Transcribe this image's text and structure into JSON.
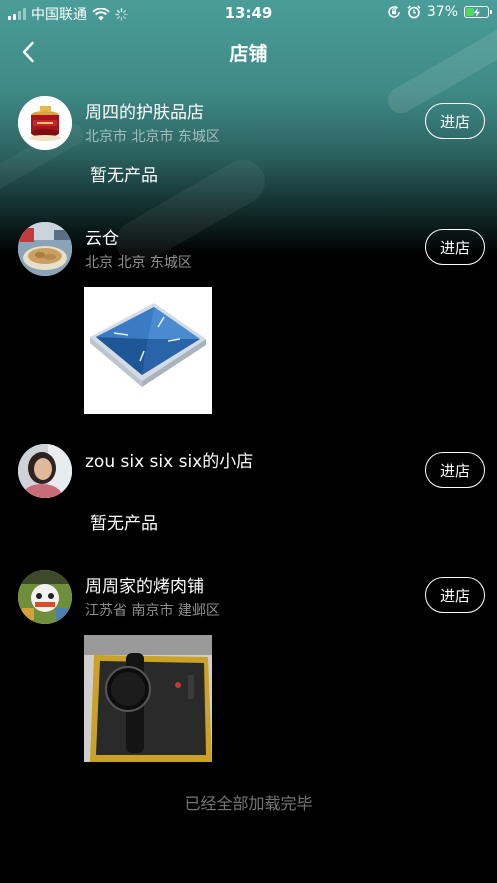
{
  "status_bar": {
    "carrier": "中国联通",
    "time": "13:49",
    "battery": "37%",
    "battery_level": 0.37
  },
  "nav": {
    "title": "店铺"
  },
  "stores": [
    {
      "name": "周四的护肤品店",
      "address": "北京市 北京市 东城区",
      "enter_label": "进店",
      "empty_text": "暂无产品"
    },
    {
      "name": "云仓",
      "address": "北京 北京 东城区",
      "enter_label": "进店"
    },
    {
      "name": "zou six six six的小店",
      "address": "",
      "enter_label": "进店",
      "empty_text": "暂无产品"
    },
    {
      "name": "周周家的烤肉铺",
      "address": "江苏省 南京市 建邺区",
      "enter_label": "进店"
    }
  ],
  "footer": {
    "text": "已经全部加载完毕"
  }
}
